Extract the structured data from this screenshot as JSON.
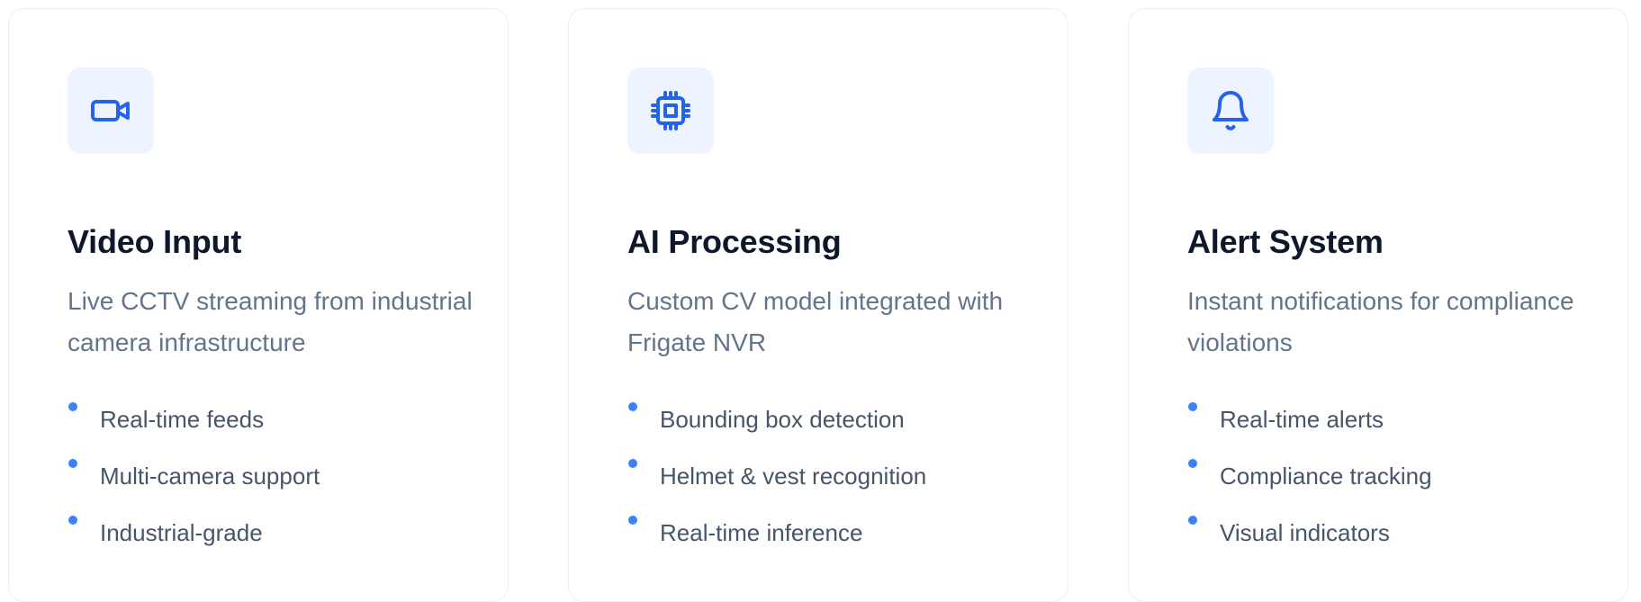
{
  "colors": {
    "accent": "#2563eb",
    "bullet": "#3b82f6",
    "icon_tile_bg": "#eef4ff",
    "title": "#0f172a",
    "description": "#64748b",
    "feature_text": "#475569"
  },
  "cards": [
    {
      "icon": "video-camera-icon",
      "title": "Video Input",
      "description": "Live CCTV streaming from industrial camera infrastructure",
      "features": [
        "Real-time feeds",
        "Multi-camera support",
        "Industrial-grade"
      ]
    },
    {
      "icon": "cpu-chip-icon",
      "title": "AI Processing",
      "description": "Custom CV model integrated with Frigate NVR",
      "features": [
        "Bounding box detection",
        "Helmet & vest recognition",
        "Real-time inference"
      ]
    },
    {
      "icon": "bell-icon",
      "title": "Alert System",
      "description": "Instant notifications for compliance violations",
      "features": [
        "Real-time alerts",
        "Compliance tracking",
        "Visual indicators"
      ]
    }
  ]
}
